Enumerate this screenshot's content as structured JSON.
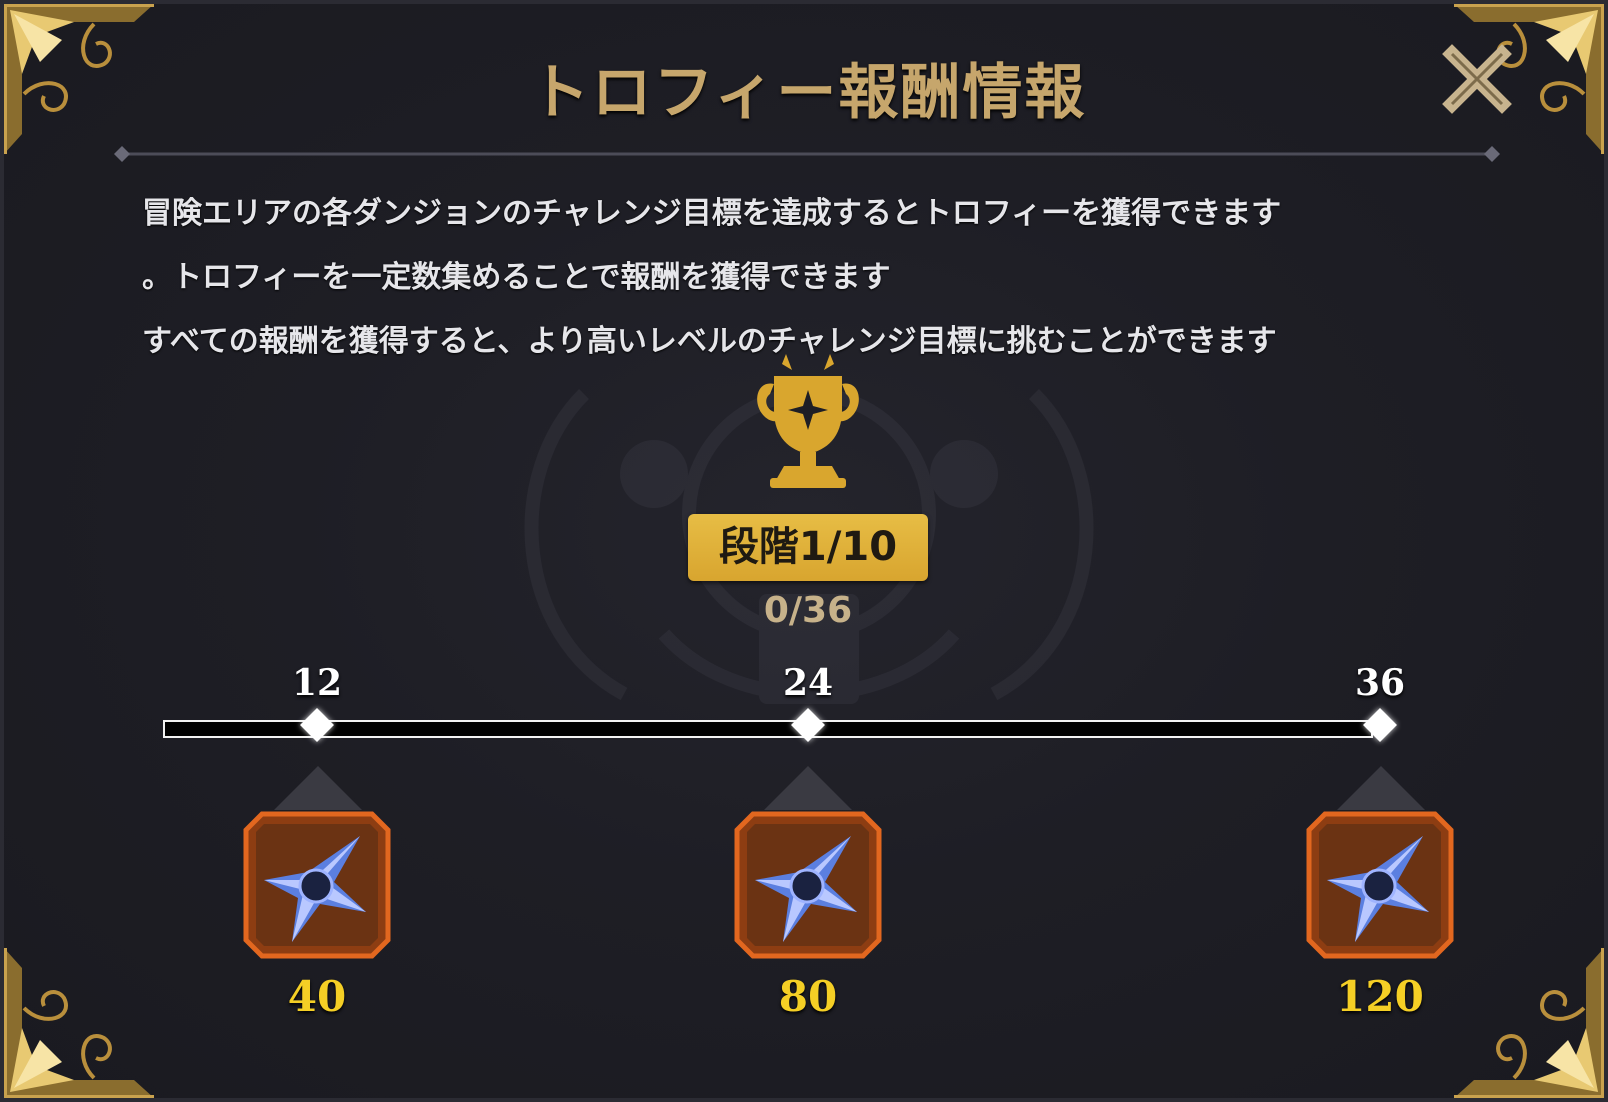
{
  "dialog": {
    "title": "トロフィー報酬情報",
    "close_icon": "close-x-icon",
    "description": [
      "冒険エリアの各ダンジョンのチャレンジ目標を達成するとトロフィーを獲得できます",
      "。トロフィーを一定数集めることで報酬を獲得できます",
      "すべての報酬を獲得すると、より高いレベルのチャレンジ目標に挑むことができます"
    ]
  },
  "trophy_icon": "gold-trophy-icon",
  "stage": {
    "label": "段階1/10",
    "progress_text": "0/36",
    "progress_fraction": 0
  },
  "milestones": [
    {
      "threshold": "12",
      "reward_icon": "crystal-shuriken-icon",
      "reward_amount": "40"
    },
    {
      "threshold": "24",
      "reward_icon": "crystal-shuriken-icon",
      "reward_amount": "80"
    },
    {
      "threshold": "36",
      "reward_icon": "crystal-shuriken-icon",
      "reward_amount": "120"
    }
  ],
  "colors": {
    "title_gold": "#c6a66c",
    "badge_gold": "#e0b03a",
    "reward_value_yellow": "#f5cf25",
    "reward_frame_orange": "#d9691e",
    "panel_bg": "#1e1e25"
  }
}
